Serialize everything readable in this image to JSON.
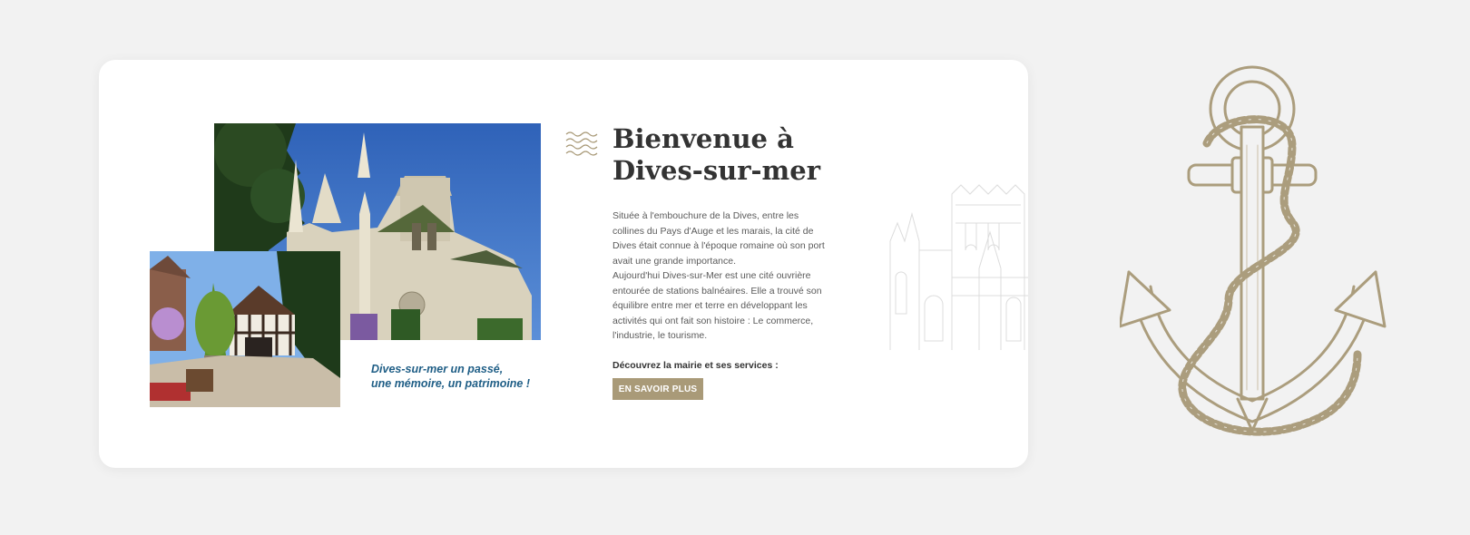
{
  "welcome": {
    "title_line1": "Bienvenue à",
    "title_line2": "Dives-sur-mer",
    "description_p1": "Située à l'embouchure de la Dives, entre les collines du Pays d'Auge et les marais, la cité de Dives était connue à l'époque romaine où son port avait une grande importance.",
    "description_p2": "Aujourd'hui Dives-sur-Mer est une cité ouvrière entourée de stations balnéaires. Elle a trouvé son équilibre entre mer et terre en développant les activités qui ont fait son histoire : Le commerce, l'industrie, le tourisme.",
    "cta_label": "Découvrez la mairie et ses services :",
    "cta_button": "EN SAVOIR PLUS"
  },
  "caption": {
    "line1": "Dives-sur-mer un passé,",
    "line2": "une mémoire, un patrimoine !"
  },
  "colors": {
    "accent": "#a99a78",
    "caption_blue": "#1f5e86",
    "background": "#f2f2f2",
    "card": "#ffffff"
  },
  "icons": [
    "waves-icon",
    "church-sketch",
    "anchor-illustration"
  ]
}
